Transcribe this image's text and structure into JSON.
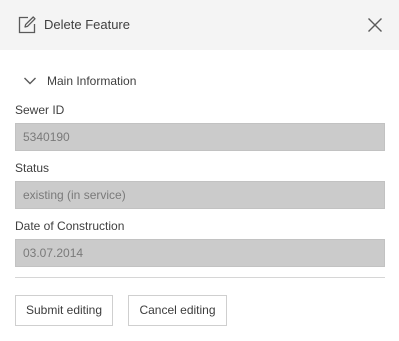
{
  "header": {
    "title": "Delete Feature",
    "edit_icon": "edit-icon",
    "close_icon": "close-icon"
  },
  "section": {
    "label": "Main Information",
    "toggle_icon": "chevron-down-icon",
    "expanded": true
  },
  "fields": [
    {
      "label": "Sewer ID",
      "value": "5340190"
    },
    {
      "label": "Status",
      "value": "existing (in service)"
    },
    {
      "label": "Date of Construction",
      "value": "03.07.2014"
    }
  ],
  "actions": {
    "submit_label": "Submit editing",
    "cancel_label": "Cancel editing"
  },
  "colors": {
    "header_bg": "#f4f4f4",
    "input_bg": "#cbcbcb",
    "text": "#3f3f3f"
  }
}
